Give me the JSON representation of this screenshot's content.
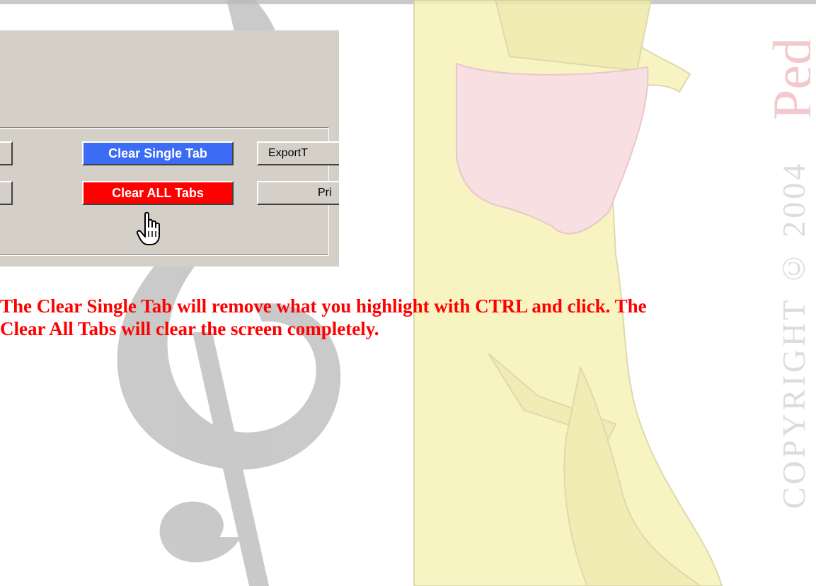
{
  "panel": {
    "buttons": {
      "clear_single": "Clear Single Tab",
      "clear_all": "Clear ALL Tabs",
      "export": "ExportT",
      "print": "Pri"
    }
  },
  "caption": {
    "line1": "The Clear Single Tab will remove what you highlight with CTRL and click. The",
    "line2": "Clear All Tabs will clear the screen completely."
  },
  "watermark": {
    "side_text": "COPYRIGHT © 2004",
    "corner_text": "Ped"
  },
  "colors": {
    "clear_single_bg": "#3c6cf5",
    "clear_all_bg": "#ff0000",
    "caption": "#ff0000",
    "panel_bg": "#d4d0c8"
  },
  "icons": {
    "cursor": "hand-pointer-cursor-icon"
  }
}
